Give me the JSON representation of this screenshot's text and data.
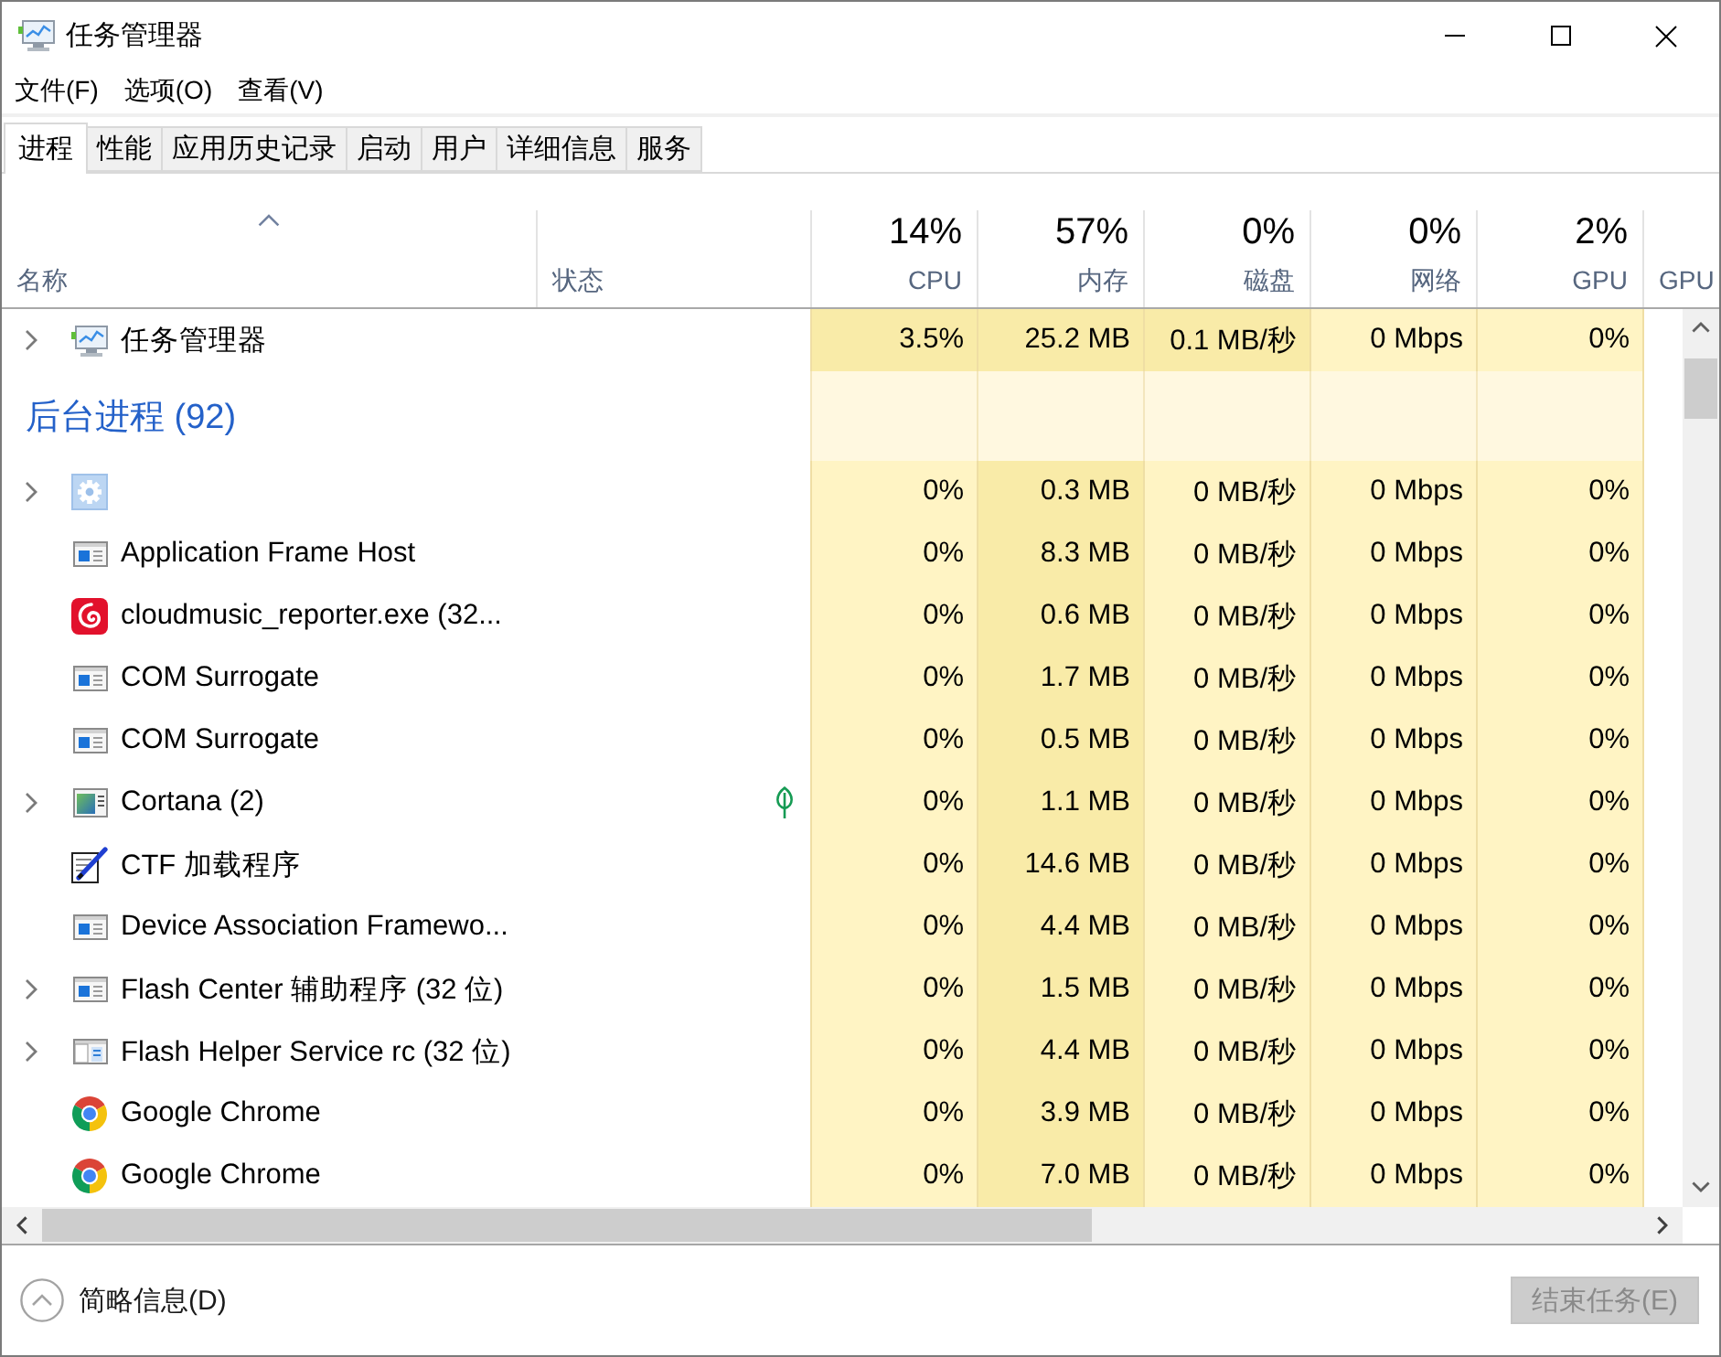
{
  "window": {
    "title": "任务管理器"
  },
  "menu": [
    "文件(F)",
    "选项(O)",
    "查看(V)"
  ],
  "tabs": [
    {
      "label": "进程",
      "selected": true
    },
    {
      "label": "性能",
      "selected": false
    },
    {
      "label": "应用历史记录",
      "selected": false
    },
    {
      "label": "启动",
      "selected": false
    },
    {
      "label": "用户",
      "selected": false
    },
    {
      "label": "详细信息",
      "selected": false
    },
    {
      "label": "服务",
      "selected": false
    }
  ],
  "table": {
    "columns": [
      {
        "label": "名称",
        "sorted": true
      },
      {
        "label": "状态",
        "sorted": false
      },
      {
        "label": "CPU",
        "usage": "14%",
        "sorted": false
      },
      {
        "label": "内存",
        "usage": "57%",
        "sorted": false
      },
      {
        "label": "磁盘",
        "usage": "0%",
        "sorted": false
      },
      {
        "label": "网络",
        "usage": "0%",
        "sorted": false
      },
      {
        "label": "GPU",
        "usage": "2%",
        "sorted": false
      },
      {
        "label": "GPU",
        "sorted": false
      }
    ],
    "rows": [
      {
        "kind": "process",
        "name": "任务管理器",
        "expandable": true,
        "suspended": false,
        "values": [
          "3.5%",
          "25.2 MB",
          "0.1 MB/秒",
          "0 Mbps",
          "0%"
        ],
        "hot": [
          true,
          true,
          true,
          false,
          false
        ]
      },
      {
        "kind": "group",
        "title": "后台进程 (92)"
      },
      {
        "kind": "process",
        "expandable": true,
        "suspended": false,
        "values": [
          "0%",
          "0.3 MB",
          "0 MB/秒",
          "0 Mbps",
          "0%"
        ],
        "hot": [
          false,
          true,
          false,
          false,
          false
        ]
      },
      {
        "kind": "process",
        "name": "Application Frame Host",
        "expandable": false,
        "suspended": false,
        "values": [
          "0%",
          "8.3 MB",
          "0 MB/秒",
          "0 Mbps",
          "0%"
        ],
        "hot": [
          false,
          true,
          false,
          false,
          false
        ]
      },
      {
        "kind": "process",
        "name": "cloudmusic_reporter.exe (32...",
        "expandable": false,
        "suspended": false,
        "values": [
          "0%",
          "0.6 MB",
          "0 MB/秒",
          "0 Mbps",
          "0%"
        ],
        "hot": [
          false,
          true,
          false,
          false,
          false
        ]
      },
      {
        "kind": "process",
        "name": "COM Surrogate",
        "expandable": false,
        "suspended": false,
        "values": [
          "0%",
          "1.7 MB",
          "0 MB/秒",
          "0 Mbps",
          "0%"
        ],
        "hot": [
          false,
          true,
          false,
          false,
          false
        ]
      },
      {
        "kind": "process",
        "name": "COM Surrogate",
        "expandable": false,
        "suspended": false,
        "values": [
          "0%",
          "0.5 MB",
          "0 MB/秒",
          "0 Mbps",
          "0%"
        ],
        "hot": [
          false,
          true,
          false,
          false,
          false
        ]
      },
      {
        "kind": "process",
        "name": "Cortana (2)",
        "expandable": true,
        "suspended": true,
        "values": [
          "0%",
          "1.1 MB",
          "0 MB/秒",
          "0 Mbps",
          "0%"
        ],
        "hot": [
          false,
          true,
          false,
          false,
          false
        ]
      },
      {
        "kind": "process",
        "name": "CTF 加载程序",
        "expandable": false,
        "suspended": false,
        "values": [
          "0%",
          "14.6 MB",
          "0 MB/秒",
          "0 Mbps",
          "0%"
        ],
        "hot": [
          false,
          true,
          false,
          false,
          false
        ]
      },
      {
        "kind": "process",
        "name": "Device Association Framewo...",
        "expandable": false,
        "suspended": false,
        "values": [
          "0%",
          "4.4 MB",
          "0 MB/秒",
          "0 Mbps",
          "0%"
        ],
        "hot": [
          false,
          true,
          false,
          false,
          false
        ]
      },
      {
        "kind": "process",
        "name": "Flash Center 辅助程序 (32 位)",
        "expandable": true,
        "suspended": false,
        "values": [
          "0%",
          "1.5 MB",
          "0 MB/秒",
          "0 Mbps",
          "0%"
        ],
        "hot": [
          false,
          true,
          false,
          false,
          false
        ]
      },
      {
        "kind": "process",
        "name": "Flash Helper Service rc (32 位)",
        "expandable": true,
        "suspended": false,
        "values": [
          "0%",
          "4.4 MB",
          "0 MB/秒",
          "0 Mbps",
          "0%"
        ],
        "hot": [
          false,
          true,
          false,
          false,
          false
        ]
      },
      {
        "kind": "process",
        "name": "Google Chrome",
        "expandable": false,
        "suspended": false,
        "values": [
          "0%",
          "3.9 MB",
          "0 MB/秒",
          "0 Mbps",
          "0%"
        ],
        "hot": [
          false,
          true,
          false,
          false,
          false
        ]
      },
      {
        "kind": "process",
        "name": "Google Chrome",
        "expandable": false,
        "suspended": false,
        "values": [
          "0%",
          "7.0 MB",
          "0 MB/秒",
          "0 Mbps",
          "0%"
        ],
        "hot": [
          false,
          true,
          false,
          false,
          false
        ]
      }
    ]
  },
  "footer": {
    "details_toggle": "简略信息(D)",
    "end_task": {
      "label": "结束任务(E)",
      "disabled": true
    }
  }
}
